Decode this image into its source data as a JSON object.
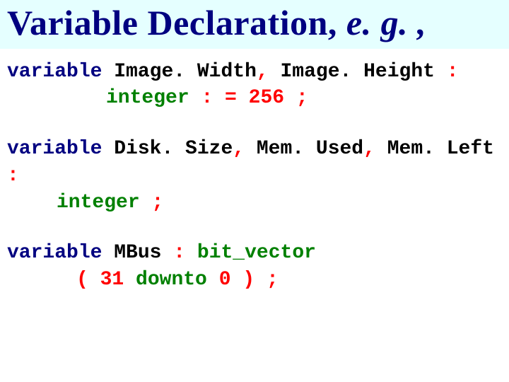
{
  "title": {
    "main": "Variable Declaration, ",
    "eg": "e. g. ,"
  },
  "code": {
    "b1": {
      "l1": {
        "kw": "variable",
        "sp": " ",
        "id": "Image. Width",
        "c1": ", ",
        "id2": "Image. Height",
        "sp2": " ",
        "col": ":"
      },
      "l2": {
        "kw": "integer",
        "sp": " ",
        "asg": ": =",
        "sp2": " ",
        "num": "256",
        "sp3": " ",
        "semi": ";"
      }
    },
    "b2": {
      "l1": {
        "kw": "variable",
        "sp": " ",
        "id": "Disk. Size",
        "c1": ", ",
        "id2": "Mem. Used",
        "c2": ", ",
        "id3": "Mem. Left",
        "sp2": " ",
        "col": ":"
      },
      "l2": {
        "kw": "integer",
        "sp": " ",
        "semi": ";"
      }
    },
    "b3": {
      "l1": {
        "kw": "variable",
        "sp": " ",
        "id": "MBus",
        "sp2": " ",
        "col": ":",
        "sp3": " ",
        "kw2": "bit_vector"
      },
      "l2": {
        "lp": "(",
        "sp": " ",
        "n1": "31",
        "sp2": " ",
        "kw": "downto",
        "sp3": " ",
        "n2": "0",
        "sp4": " ",
        "rp": ")",
        "sp5": " ",
        "semi": ";"
      }
    }
  }
}
